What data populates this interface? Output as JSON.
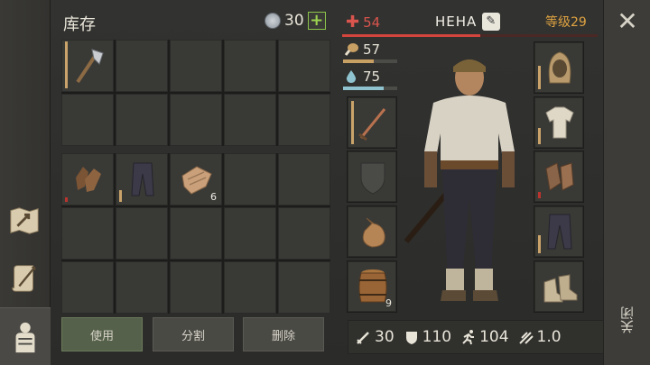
{
  "inventory": {
    "title": "库存",
    "coins": "30",
    "coin_add": "+",
    "items": [
      {
        "icon": "hatchet-icon",
        "bar": 1.0
      },
      {
        "icon": "gloves-icon",
        "bar": 0.1
      },
      {
        "icon": "trousers-icon",
        "bar": 0.25
      },
      {
        "icon": "rags-icon",
        "count": "6"
      }
    ],
    "buttons": {
      "use": "使用",
      "split": "分割",
      "delete": "删除"
    }
  },
  "character": {
    "health": "54",
    "health_fraction": 0.54,
    "name": "HEHA",
    "level": "等级29",
    "food": "57",
    "food_fraction": 0.57,
    "water": "75",
    "water_fraction": 0.75
  },
  "equipment": {
    "left": [
      {
        "icon": "sword-icon"
      },
      {
        "icon": "shield-slot-icon"
      },
      {
        "icon": "bag-icon"
      },
      {
        "icon": "barrel-icon",
        "count": "9"
      }
    ],
    "right": [
      {
        "icon": "hood-icon"
      },
      {
        "icon": "shirt-icon"
      },
      {
        "icon": "bracers-icon"
      },
      {
        "icon": "pants-icon"
      },
      {
        "icon": "boots-icon"
      }
    ]
  },
  "stats": {
    "attack": "30",
    "armor": "110",
    "speed": "104",
    "attack_speed": "1.0"
  },
  "close": {
    "label": "关闭"
  },
  "colors": {
    "health": "#d3453d",
    "food": "#c9a064",
    "water": "#8ec3cf",
    "level": "#e0a442",
    "accent": "#9bd14f"
  }
}
